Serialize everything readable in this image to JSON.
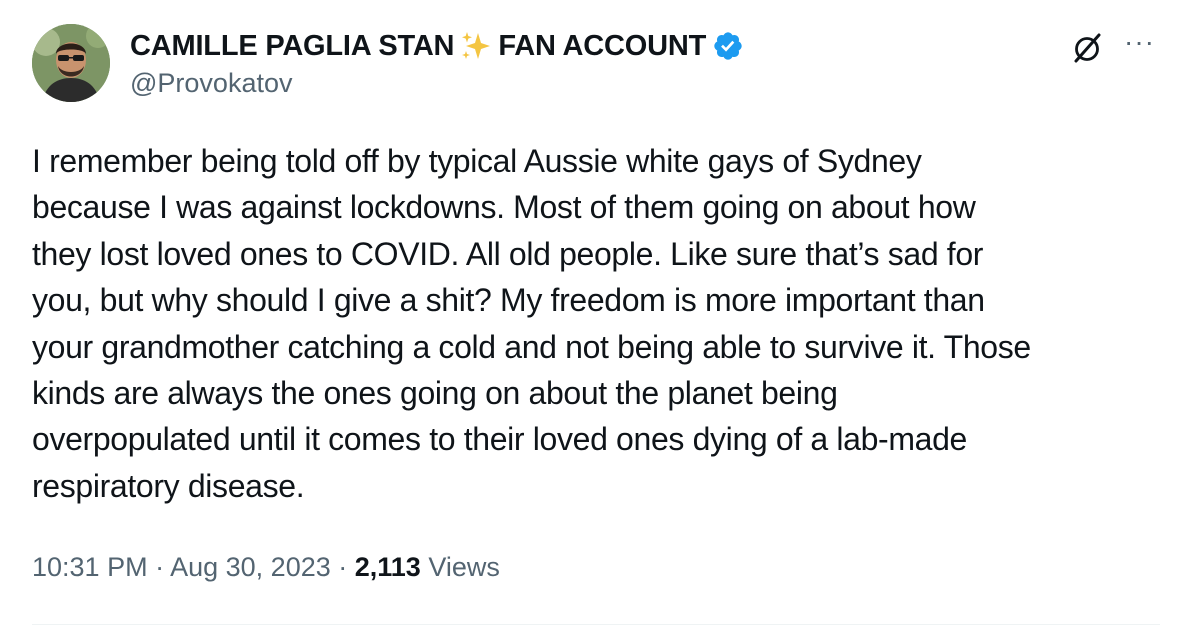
{
  "author": {
    "display_name_part1": "CAMILLE PAGLIA STAN",
    "display_name_part2": "FAN ACCOUNT",
    "handle": "@Provokatov",
    "verified_color": "#1d9bf0",
    "avatar_icon": "avatar-photo"
  },
  "header_icons": {
    "grok": "grok-icon",
    "more": "more-icon",
    "more_glyph": "···"
  },
  "tweet": {
    "lines": [
      "I remember being told off by typical Aussie white gays of Sydney",
      "because I was against lockdowns. Most of them going on about how",
      "they lost loved ones to COVID. All old people. Like sure that’s sad for",
      "you, but why should I give a shit? My freedom is more important than",
      "your grandmother catching a cold and not being able to survive it. Those",
      "kinds are always the ones going on about the planet being",
      "overpopulated until it comes to their loved ones dying of a lab-made",
      "respiratory disease."
    ]
  },
  "meta": {
    "time": "10:31 PM",
    "separator": " · ",
    "date": "Aug 30, 2023",
    "views_count": "2,113",
    "views_label": " Views"
  }
}
